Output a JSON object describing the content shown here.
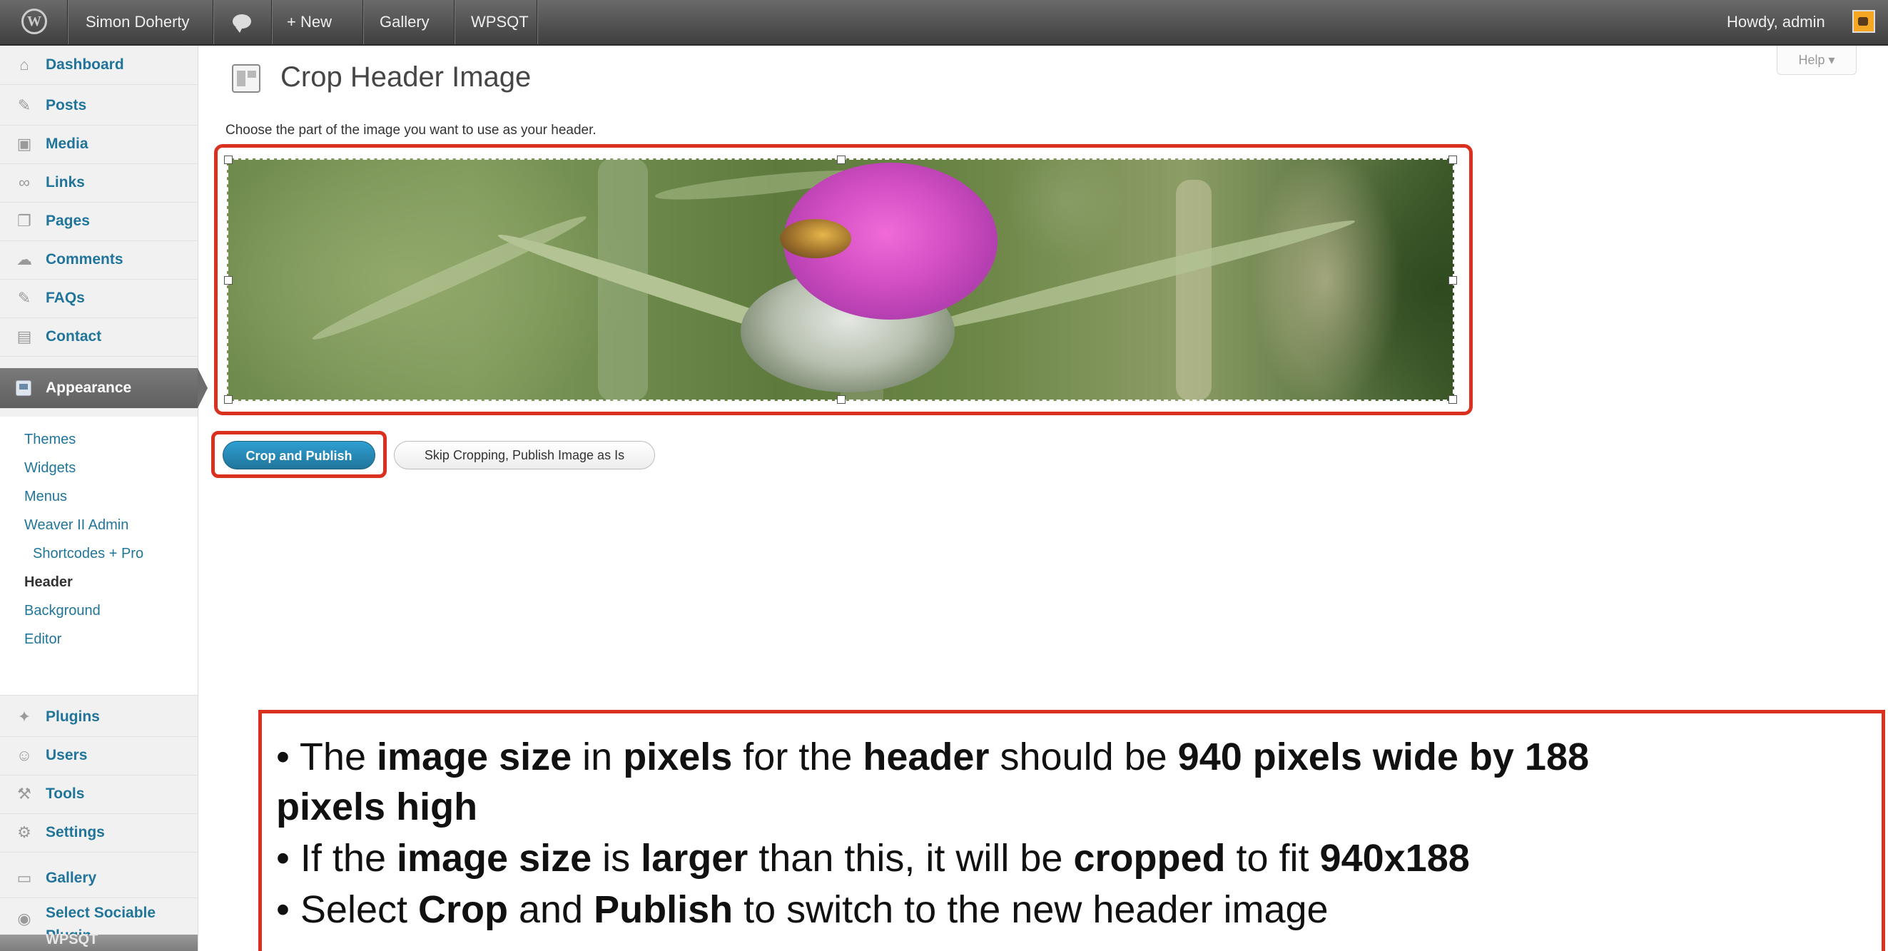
{
  "admin_bar": {
    "wp_logo": "W",
    "site_name": "Simon Doherty",
    "comments_icon": "comment-bubble-icon",
    "new_label": "+ New",
    "gallery_label": "Gallery",
    "wpsqt_label": "WPSQT",
    "howdy": "Howdy, admin"
  },
  "sidebar": {
    "items": [
      {
        "label": "Dashboard",
        "icon": "⌂"
      },
      {
        "label": "Posts",
        "icon": "✎"
      },
      {
        "label": "Media",
        "icon": "▣"
      },
      {
        "label": "Links",
        "icon": "∞"
      },
      {
        "label": "Pages",
        "icon": "❐"
      },
      {
        "label": "Comments",
        "icon": "☁"
      },
      {
        "label": "FAQs",
        "icon": "✎"
      },
      {
        "label": "Contact",
        "icon": "▤"
      },
      {
        "label": "Appearance",
        "icon": ""
      }
    ],
    "submenu": [
      "Themes",
      "Widgets",
      "Menus",
      "Weaver II Admin",
      "Shortcodes + Pro",
      "Header",
      "Background",
      "Editor"
    ],
    "lower_items": [
      {
        "label": "Plugins",
        "icon": "✦"
      },
      {
        "label": "Users",
        "icon": "☺"
      },
      {
        "label": "Tools",
        "icon": "⚒"
      },
      {
        "label": "Settings",
        "icon": "⚙"
      },
      {
        "label": "Gallery",
        "icon": "▭"
      },
      {
        "label": "Select Sociable",
        "label2": "Plugin",
        "icon": "◉"
      },
      {
        "label": "WPSQT",
        "icon": ""
      }
    ]
  },
  "main": {
    "help_label": "Help ▾",
    "title": "Crop Header Image",
    "instructions": "Choose the part of the image you want to use as your header.",
    "crop_button": "Crop and Publish",
    "skip_button": "Skip Cropping, Publish Image as Is"
  },
  "callout": {
    "line1": [
      "• The ",
      "image size",
      " in ",
      "pixels",
      " for the ",
      "header",
      " should be ",
      "940 pixels wide by 188"
    ],
    "line2": [
      "pixels high"
    ],
    "line3": [
      "• If the ",
      "image size",
      " is ",
      "larger",
      " than this, it will be ",
      "cropped",
      " to fit ",
      "940x188"
    ],
    "line4": [
      "• Select ",
      "Crop",
      " and ",
      "Publish",
      " to switch to the new header image"
    ]
  },
  "colors": {
    "accent": "#21759b",
    "highlight": "#d93020",
    "flower": "#d44fc4"
  }
}
